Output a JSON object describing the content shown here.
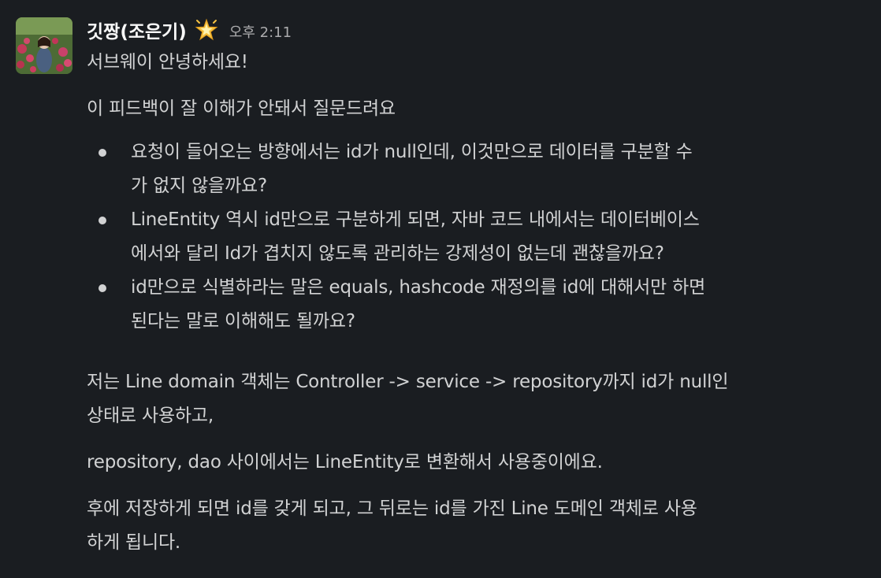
{
  "message": {
    "author": "깃짱(조은기)",
    "status_emoji": "sparkle-star-icon",
    "timestamp": "오후 2:11",
    "greeting": "서브웨이 안녕하세요!",
    "intro": "이 피드백이 잘 이해가 안돼서 질문드려요",
    "bullets": [
      {
        "lines": [
          "요청이 들어오는 방향에서는 id가 null인데, 이것만으로 데이터를 구분할 수",
          "가 없지 않을까요?"
        ]
      },
      {
        "lines": [
          "LineEntity 역시 id만으로 구분하게 되면, 자바 코드 내에서는 데이터베이스",
          "에서와 달리 Id가 겹치지 않도록 관리하는 강제성이 없는데 괜찮을까요?"
        ]
      },
      {
        "lines": [
          "id만으로 식별하라는 말은 equals, hashcode 재정의를 id에 대해서만 하면",
          "된다는 말로 이해해도 될까요?"
        ]
      }
    ],
    "paragraph_domain": [
      "저는 Line domain 객체는 Controller -> service -> repository까지 id가 null인",
      "상태로 사용하고,"
    ],
    "paragraph_entity": "repository, dao 사이에서는 LineEntity로 변환해서 사용중이에요.",
    "paragraph_save": [
      "후에 저장하게 되면 id를 갖게 되고, 그 뒤로는 id를 가진 Line 도메인 객체로 사용",
      "하게 됩니다."
    ]
  },
  "colors": {
    "background": "#1a1d21",
    "text": "#d1d2d3",
    "author": "#f8f8f8",
    "timestamp": "#ababad"
  }
}
